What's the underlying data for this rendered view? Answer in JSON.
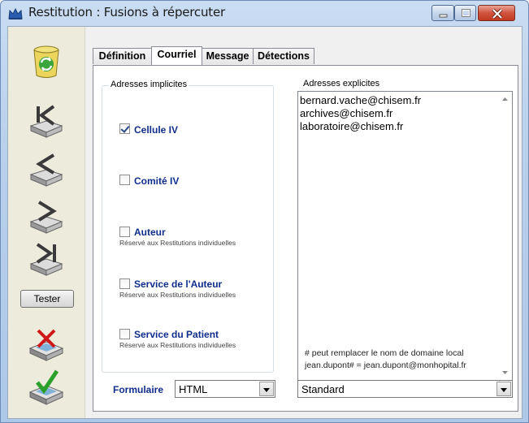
{
  "window": {
    "title": "Restitution : Fusions à répercuter",
    "icons": {
      "app": "crown-app-icon",
      "minimize": "minimize-icon",
      "maximize": "maximize-icon",
      "close": "close-icon"
    }
  },
  "toolbar": {
    "icons": [
      "refresh-icon",
      "move-first-icon",
      "move-previous-icon",
      "move-next-icon",
      "move-last-icon",
      "cancel-icon",
      "validate-icon"
    ],
    "tester_label": "Tester"
  },
  "tabs": [
    {
      "label": "Définition",
      "active": false
    },
    {
      "label": "Courriel",
      "active": true
    },
    {
      "label": "Message",
      "active": false
    },
    {
      "label": "Détections",
      "active": false
    }
  ],
  "implicit": {
    "title": "Adresses implicites",
    "items": [
      {
        "label": "Cellule IV",
        "checked": true,
        "note": ""
      },
      {
        "label": "Comité IV",
        "checked": false,
        "note": ""
      },
      {
        "label": "Auteur",
        "checked": false,
        "note": "Réservé aux Restitutions individuelles"
      },
      {
        "label": "Service de l'Auteur",
        "checked": false,
        "note": "Réservé aux Restitutions individuelles"
      },
      {
        "label": "Service du Patient",
        "checked": false,
        "note": "Réservé aux Restitutions individuelles"
      }
    ]
  },
  "explicit": {
    "title": "Adresses explicites",
    "addresses": [
      "bernard.vache@chisem.fr",
      "archives@chisem.fr",
      "laboratoire@chisem.fr"
    ],
    "hint_line1": "# peut remplacer le nom de domaine local",
    "hint_line2": "jean.dupont# = jean.dupont@monhopital.fr"
  },
  "form": {
    "label": "Formulaire",
    "format_value": "HTML",
    "template_value": "Standard"
  },
  "colors": {
    "accent": "#102e8c",
    "title_bg": "#b7cfeb",
    "close": "#c23a22"
  }
}
